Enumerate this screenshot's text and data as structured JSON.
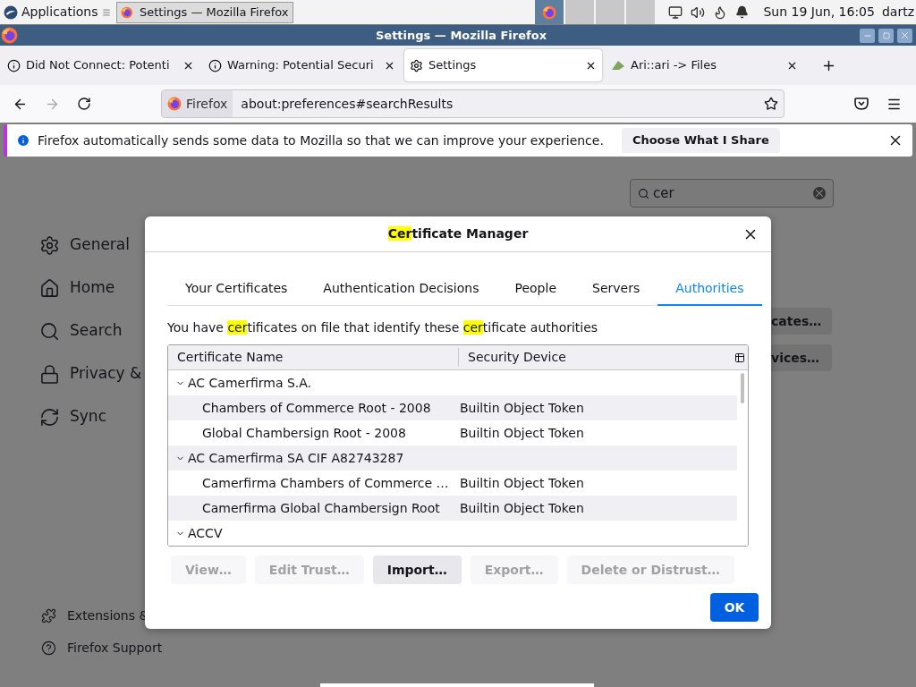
{
  "top_panel": {
    "applications": "Applications",
    "taskbar": [
      {
        "title": "Settings — Mozilla Firefox",
        "selected": true
      }
    ],
    "workspaces": [
      {
        "selected": true
      },
      {
        "selected": false
      },
      {
        "selected": false
      },
      {
        "selected": false
      }
    ],
    "clock": "Sun 19 Jun, 16:05",
    "user": "dartz"
  },
  "window": {
    "title": "Settings — Mozilla Firefox"
  },
  "tabs": [
    {
      "label": "Did Not Connect: Potenti",
      "kind": "info",
      "selected": false
    },
    {
      "label": "Warning: Potential Securi",
      "kind": "info",
      "selected": false
    },
    {
      "label": "Settings",
      "kind": "settings",
      "selected": true
    },
    {
      "label": "Ari::ari -> Files",
      "kind": "site",
      "selected": false
    }
  ],
  "toolbar": {
    "identity": "Firefox",
    "url": "about:preferences#searchResults"
  },
  "notification": {
    "message": "Firefox automatically sends some data to Mozilla so that we can improve your experience.",
    "button": "Choose What I Share"
  },
  "settings": {
    "search": {
      "value": "cer"
    },
    "nav": [
      {
        "label": "General",
        "kind": "general"
      },
      {
        "label": "Home",
        "kind": "home"
      },
      {
        "label": "Search",
        "kind": "search"
      },
      {
        "label": "Privacy &",
        "kind": "privacy"
      },
      {
        "label": "Sync",
        "kind": "sync"
      }
    ],
    "footer": [
      {
        "label": "Extensions &",
        "kind": "extensions"
      },
      {
        "label": "Firefox Support",
        "kind": "support"
      }
    ],
    "buttons": [
      "cates…",
      "vices…"
    ]
  },
  "dialog": {
    "title": [
      {
        "text": "Cer",
        "highlighted": true
      },
      {
        "text": "tificate Manager",
        "highlighted": false
      }
    ],
    "tabs": [
      {
        "label": "Your Certificates",
        "selected": false
      },
      {
        "label": "Authentication Decisions",
        "selected": false
      },
      {
        "label": "People",
        "selected": false
      },
      {
        "label": "Servers",
        "selected": false
      },
      {
        "label": "Authorities",
        "selected": true
      }
    ],
    "description": [
      {
        "text": "You have ",
        "highlighted": false
      },
      {
        "text": "cer",
        "highlighted": true
      },
      {
        "text": "tificates on file that identify these ",
        "highlighted": false
      },
      {
        "text": "cer",
        "highlighted": true
      },
      {
        "text": "tificate authorities",
        "highlighted": false
      }
    ],
    "columns": [
      "Certificate Name",
      "Security Device"
    ],
    "rows": [
      {
        "name": "AC Camerfirma S.A.",
        "expanded": true,
        "children": [
          {
            "name": "Chambers of Commerce Root - 2008",
            "device": "Builtin Object Token"
          },
          {
            "name": "Global Chambersign Root - 2008",
            "device": "Builtin Object Token"
          }
        ]
      },
      {
        "name": "AC Camerfirma SA CIF A82743287",
        "expanded": true,
        "children": [
          {
            "name": "Camerfirma Chambers of Commerce …",
            "device": "Builtin Object Token"
          },
          {
            "name": "Camerfirma Global Chambersign Root",
            "device": "Builtin Object Token"
          }
        ]
      },
      {
        "name": "ACCV",
        "expanded": true
      }
    ],
    "buttons": [
      {
        "label": "View…",
        "disabled": true
      },
      {
        "label": "Edit Trust…",
        "disabled": true
      },
      {
        "label": "Import…",
        "disabled": false
      },
      {
        "label": "Export…",
        "disabled": true
      },
      {
        "label": "Delete or Distrust…",
        "disabled": true
      }
    ],
    "ok": "OK"
  }
}
